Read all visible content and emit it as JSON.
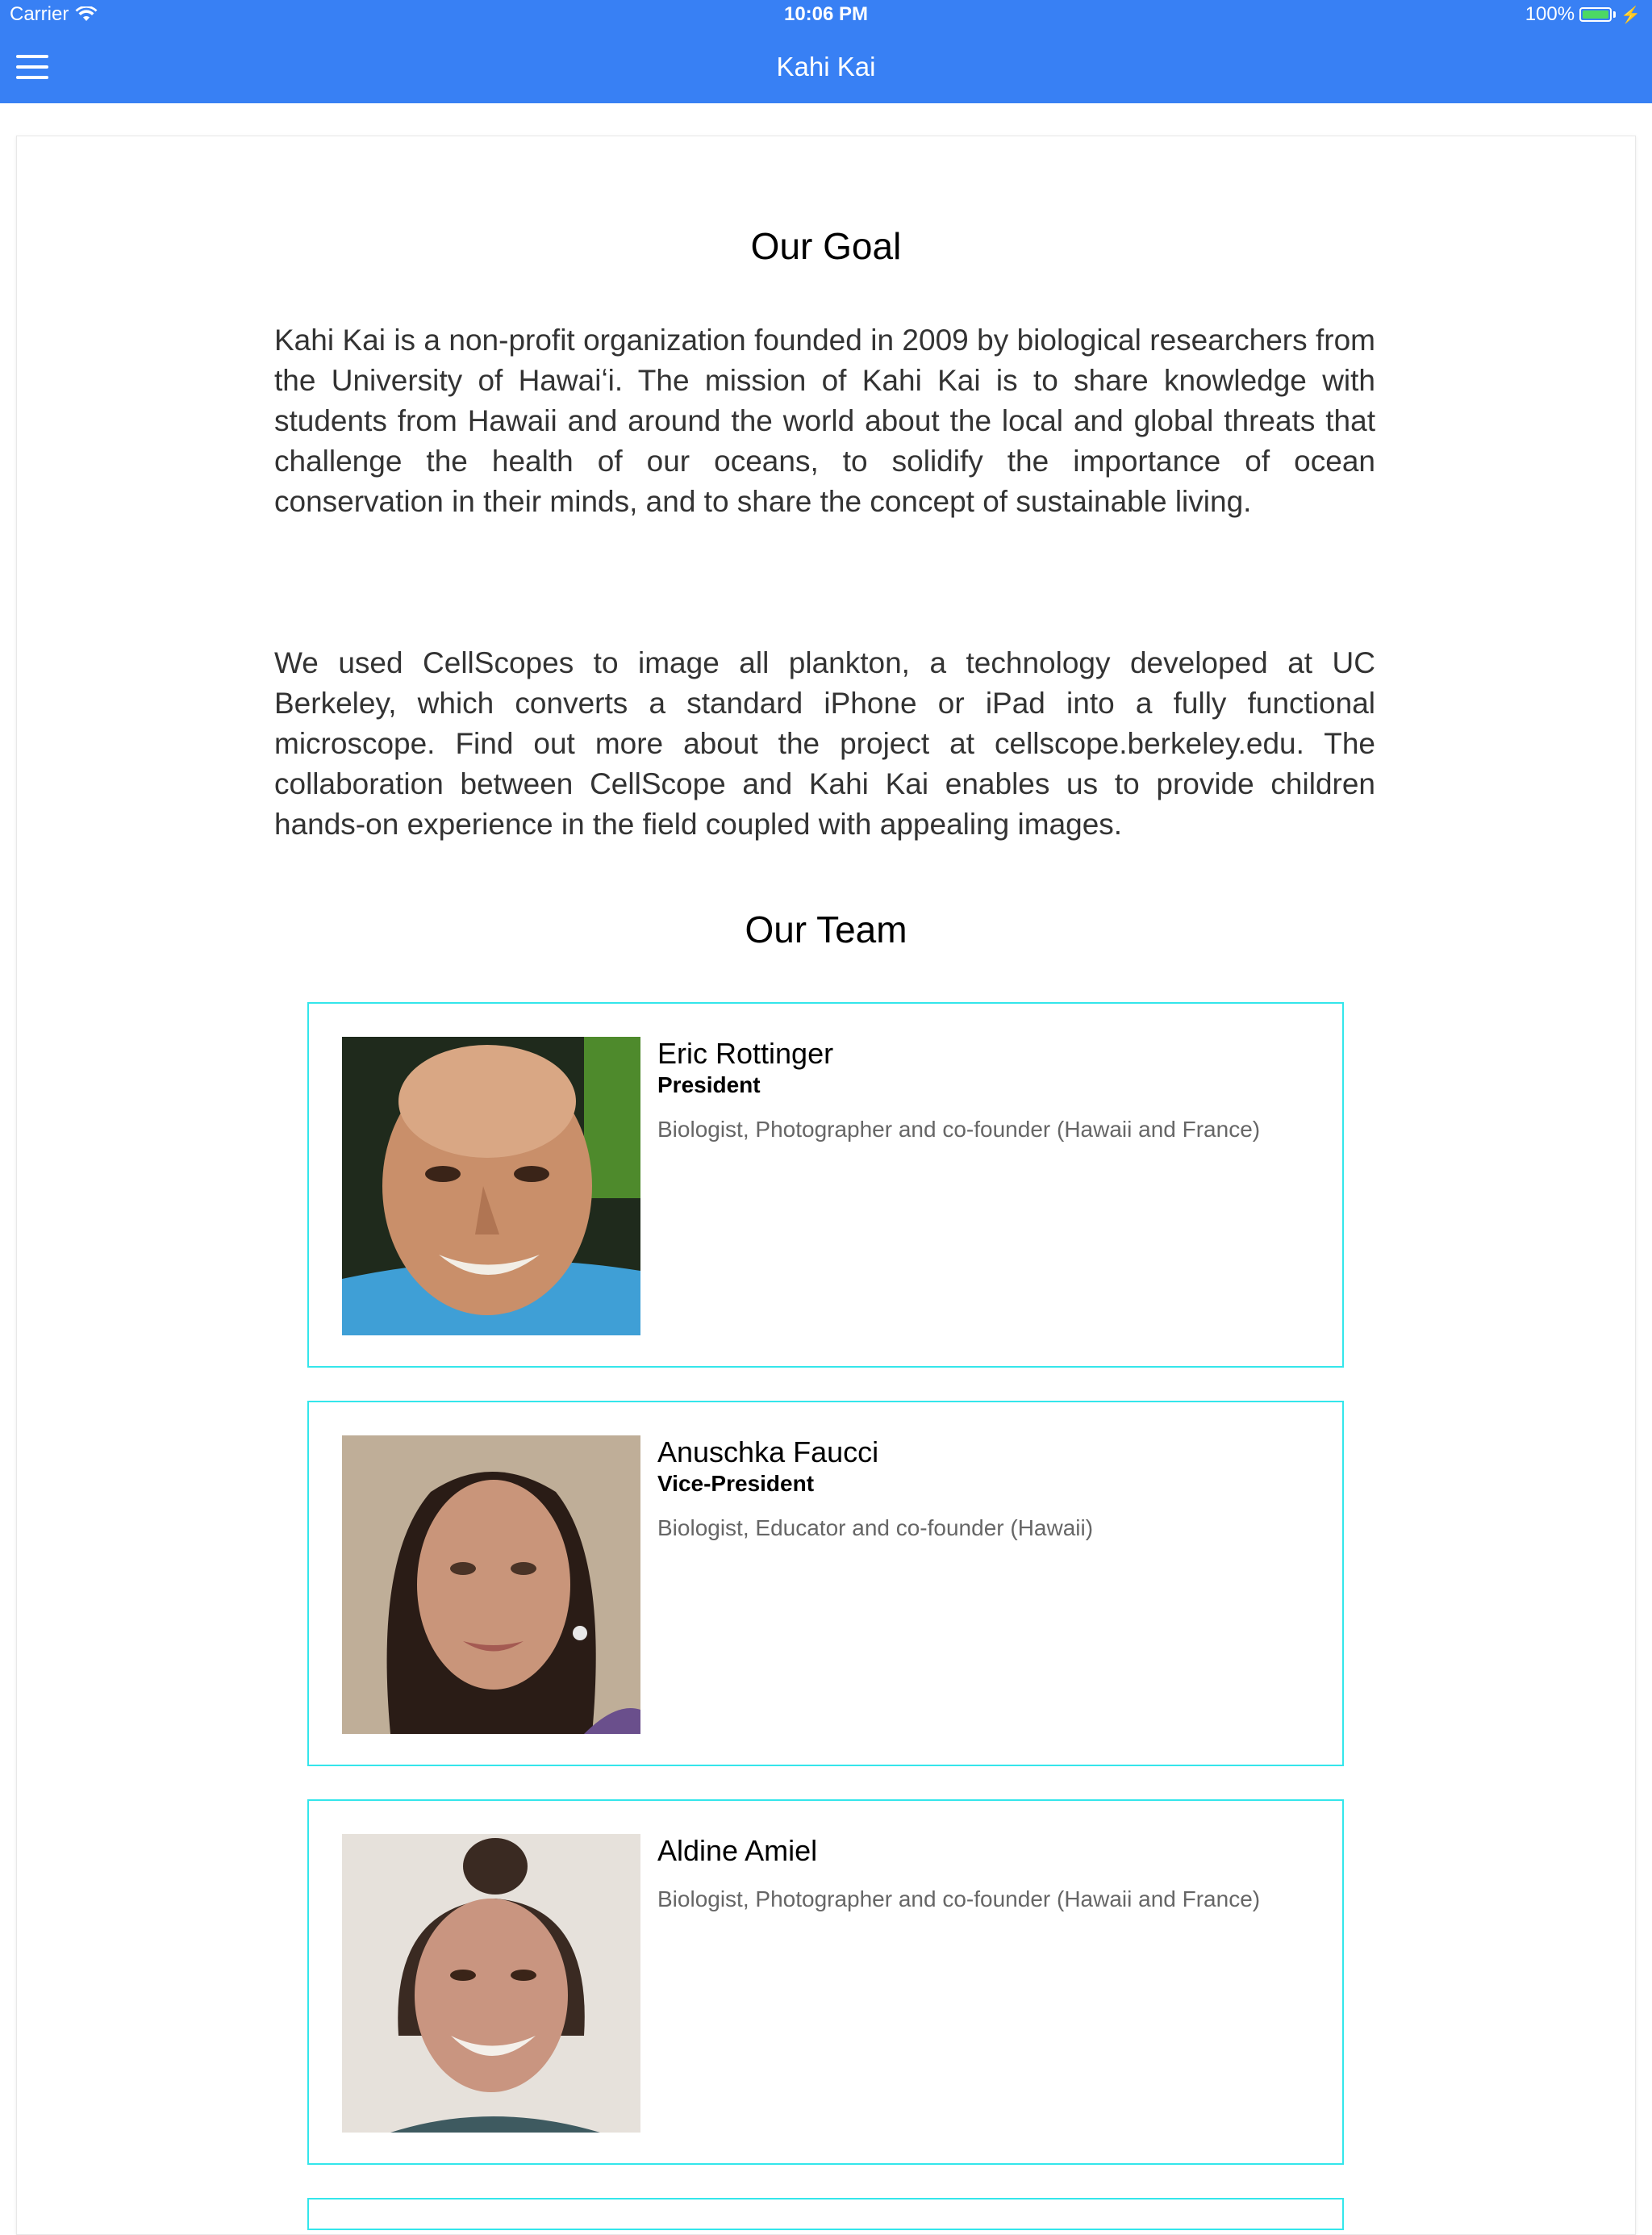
{
  "status_bar": {
    "carrier": "Carrier",
    "time": "10:06 PM",
    "battery": "100%",
    "battery_level": 1.0
  },
  "nav": {
    "title": "Kahi Kai"
  },
  "goal": {
    "heading": "Our Goal",
    "paragraphs": [
      "Kahi Kai is a non-profit organization founded in 2009 by biological researchers from the University of Hawaiʻi. The mission of Kahi Kai is to share knowledge with students from Hawaii and around the world about the local and global threats that challenge the health of our oceans, to solidify the importance of ocean conservation in their minds, and to share the concept of sustainable living.",
      "We used CellScopes to image all plankton, a technology developed at UC Berkeley, which converts a standard iPhone or iPad into a fully functional microscope. Find out more about the project at cellscope.berkeley.edu. The collaboration between CellScope and Kahi Kai enables us to provide children hands-on experience in the field coupled with appealing images."
    ]
  },
  "team": {
    "heading": "Our Team",
    "members": [
      {
        "name": "Eric Rottinger",
        "role": "President",
        "bio": "Biologist, Photographer and co-founder (Hawaii and France)"
      },
      {
        "name": "Anuschka Faucci",
        "role": "Vice-President",
        "bio": "Biologist, Educator and co-founder (Hawaii)"
      },
      {
        "name": "Aldine Amiel",
        "role": "",
        "bio": "Biologist, Photographer and co-founder (Hawaii and France)"
      }
    ]
  },
  "colors": {
    "nav_bg": "#3880F4",
    "card_border": "#34E6EB",
    "battery": "#4CD964"
  }
}
